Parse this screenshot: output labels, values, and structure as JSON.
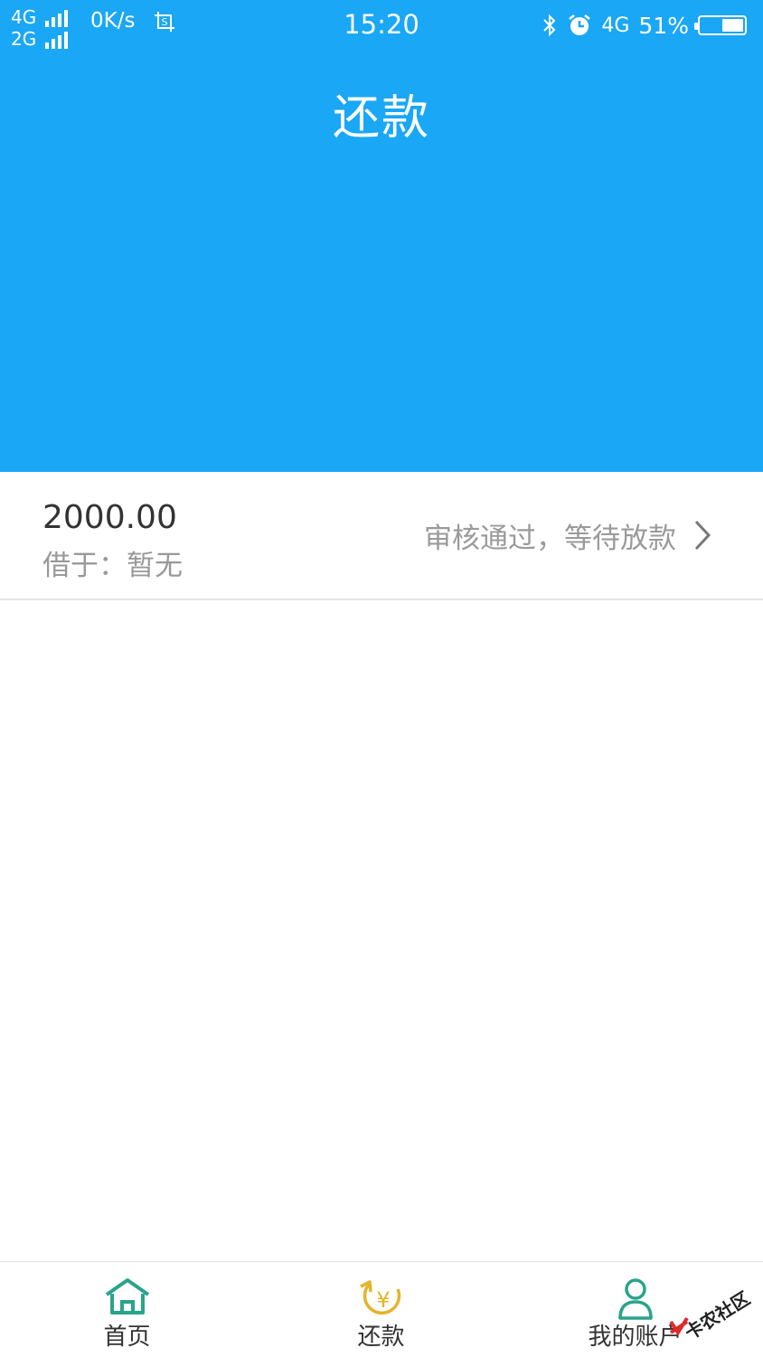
{
  "status_bar": {
    "net1": "4G",
    "net2": "2G",
    "speed": "0K/s",
    "time": "15:20",
    "net3": "4G",
    "battery": "51%",
    "battery_level": 0.51
  },
  "header": {
    "title": "还款",
    "bg_color": "#1aa7f5"
  },
  "loan": {
    "amount": "2000.00",
    "borrowed_from": "借于：暂无",
    "status": "审核通过，等待放款"
  },
  "tabs": [
    {
      "label": "首页",
      "icon": "home-icon",
      "color": "#29a48a"
    },
    {
      "label": "还款",
      "icon": "repay-yen-icon",
      "color": "#e5b429"
    },
    {
      "label": "我的账户",
      "icon": "user-icon",
      "color": "#29a48a"
    }
  ],
  "watermark": "卡农社区"
}
